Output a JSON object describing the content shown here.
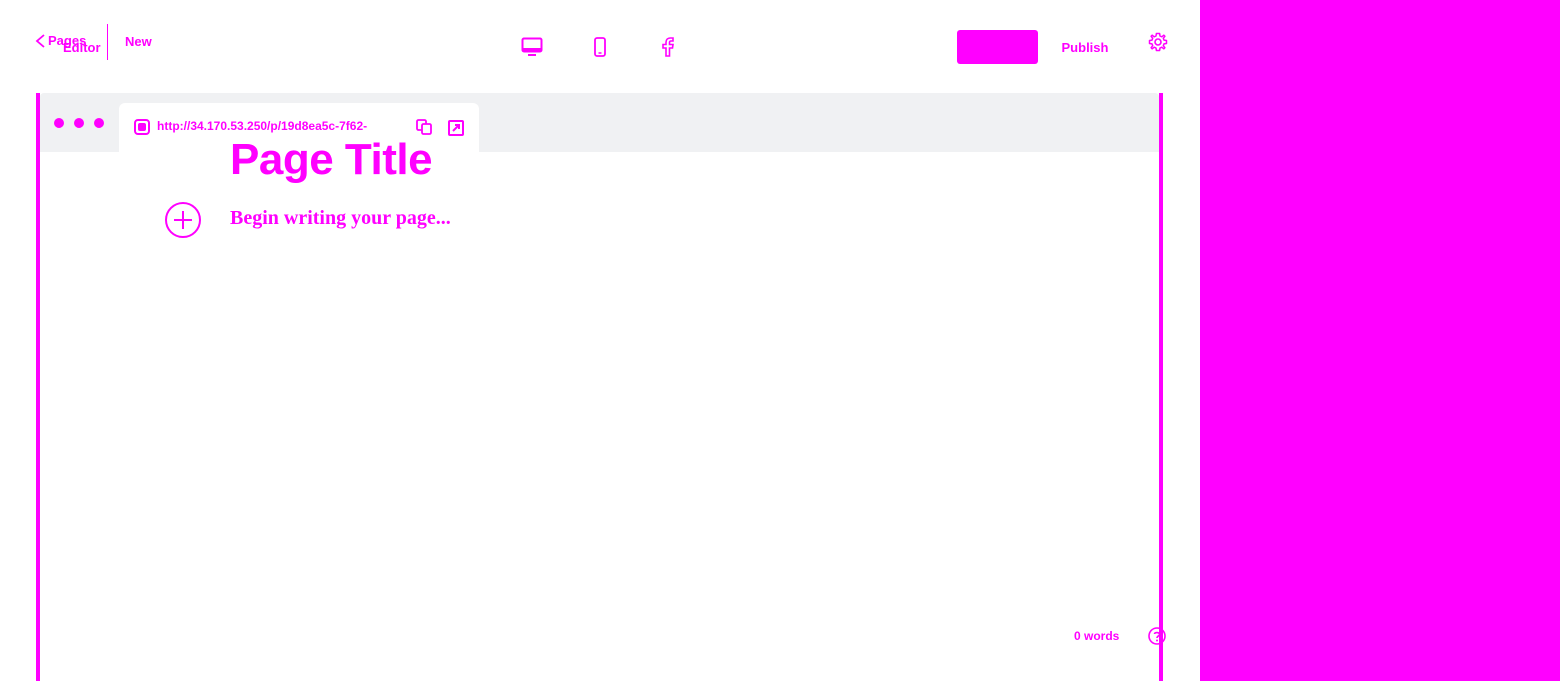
{
  "header": {
    "back_label": "Pages",
    "editor_label": "Editor",
    "status": "New",
    "view_modes": [
      "desktop",
      "mobile",
      "facebook"
    ],
    "save_label": "",
    "publish_label": "Publish",
    "settings_icon": "gear-icon"
  },
  "preview": {
    "url": "http://34.170.53.250/p/19d8ea5c-7f62-...",
    "page_title": "Page Title",
    "body_placeholder": "Begin writing your page...",
    "word_count": "0 words"
  },
  "colors": {
    "accent": "#ff00ff",
    "frame_bar": "#f0f1f3",
    "background": "#ffffff"
  }
}
